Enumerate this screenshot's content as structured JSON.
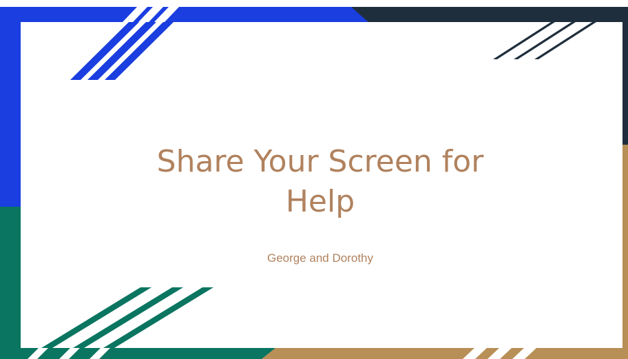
{
  "slide": {
    "title": "Share Your Screen for Help",
    "subtitle": "George and Dorothy"
  },
  "theme": {
    "blue": "#1a3ee0",
    "navy": "#1f2e3c",
    "teal": "#0a7560",
    "gold": "#b88f56",
    "text": "#b0825e",
    "background": "#ffffff"
  }
}
